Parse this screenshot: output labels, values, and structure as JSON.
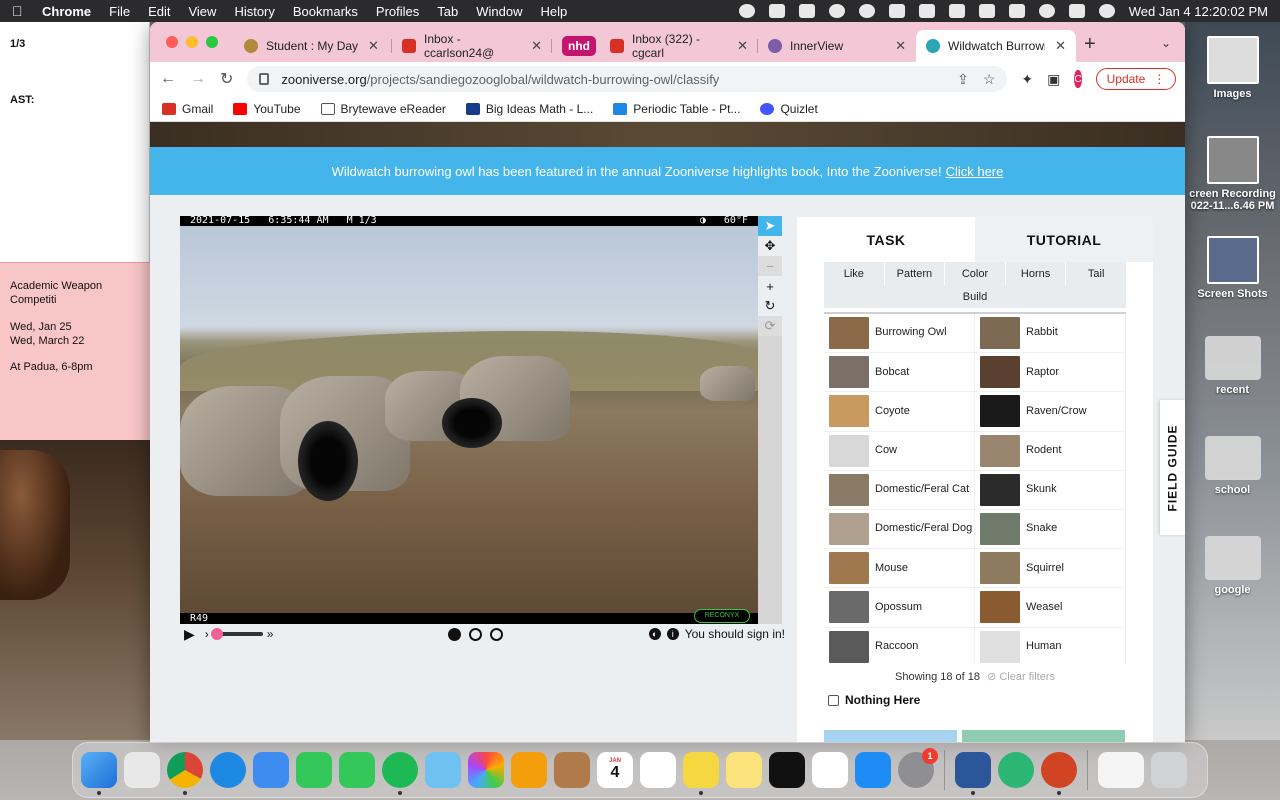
{
  "menubar": {
    "app": "Chrome",
    "items": [
      "File",
      "Edit",
      "View",
      "History",
      "Bookmarks",
      "Profiles",
      "Tab",
      "Window",
      "Help"
    ],
    "datetime": "Wed Jan 4  12:20:02 PM"
  },
  "sticky_white": {
    "line1": "1/3",
    "line2": "AST:"
  },
  "sticky_pink": {
    "title": "Academic Weapon Competiti",
    "date1": "Wed, Jan 25",
    "date2": "Wed, March 22",
    "place": "At Padua, 6-8pm"
  },
  "desktop_icons": [
    {
      "label": "Images"
    },
    {
      "label": "creen Recording\n022-11...6.46 PM"
    },
    {
      "label": "Screen Shots"
    },
    {
      "label": "recent"
    },
    {
      "label": "school"
    },
    {
      "label": "google"
    }
  ],
  "tabs": [
    {
      "title": "Student : My Day",
      "color": "#b08a3a"
    },
    {
      "title": "Inbox - ccarlson24@",
      "color": "#d93025"
    },
    {
      "title": "nhd",
      "color": "#c4156e"
    },
    {
      "title": "Inbox (322) - cgcarl",
      "color": "#d93025"
    },
    {
      "title": "InnerView",
      "color": "#7b5ea7"
    },
    {
      "title": "Wildwatch Burrowin",
      "color": "#2aa6b5"
    }
  ],
  "omnibox": {
    "host": "zooniverse.org",
    "path": "/projects/sandiegozooglobal/wildwatch-burrowing-owl/classify"
  },
  "update_label": "Update",
  "profile_initial": "C",
  "bookmarks": [
    {
      "label": "Gmail",
      "color": "#d93025"
    },
    {
      "label": "YouTube",
      "color": "#ff0000"
    },
    {
      "label": "Brytewave eReader",
      "color": "#555555"
    },
    {
      "label": "Big Ideas Math - L...",
      "color": "#1a3a8a"
    },
    {
      "label": "Periodic Table - Pt...",
      "color": "#1e88e5"
    },
    {
      "label": "Quizlet",
      "color": "#4255ff"
    }
  ],
  "banner": {
    "text": "Wildwatch burrowing owl has been featured in the annual Zooniverse highlights book, Into the Zooniverse!",
    "link": "Click here"
  },
  "camera": {
    "date": "2021-07-15",
    "time": "6:35:44 AM",
    "frame": "M 1/3",
    "temp": "60°F",
    "camera_id": "R49",
    "brand": "RECONYX"
  },
  "signin_text": "You should sign in!",
  "task_tabs": [
    "TASK",
    "TUTORIAL"
  ],
  "filters": [
    "Like",
    "Pattern",
    "Color",
    "Horns",
    "Tail"
  ],
  "filter_build": "Build",
  "choices": [
    {
      "label": "Burrowing Owl",
      "color": "#8a6a48"
    },
    {
      "label": "Rabbit",
      "color": "#7d6a55"
    },
    {
      "label": "Bobcat",
      "color": "#7a7068"
    },
    {
      "label": "Raptor",
      "color": "#5a4030"
    },
    {
      "label": "Coyote",
      "color": "#c89a60"
    },
    {
      "label": "Raven/Crow",
      "color": "#1a1a1a"
    },
    {
      "label": "Cow",
      "color": "#d8d8d8"
    },
    {
      "label": "Rodent",
      "color": "#9a8670"
    },
    {
      "label": "Domestic/Feral Cat",
      "color": "#8a7a66"
    },
    {
      "label": "Skunk",
      "color": "#2b2b2b"
    },
    {
      "label": "Domestic/Feral Dog",
      "color": "#b0a090"
    },
    {
      "label": "Snake",
      "color": "#6f7a6a"
    },
    {
      "label": "Mouse",
      "color": "#a07850"
    },
    {
      "label": "Squirrel",
      "color": "#8e7a5e"
    },
    {
      "label": "Opossum",
      "color": "#6a6a6a"
    },
    {
      "label": "Weasel",
      "color": "#8a5a30"
    },
    {
      "label": "Raccoon",
      "color": "#5a5a5a"
    },
    {
      "label": "Human",
      "color": "#e0e0e0"
    }
  ],
  "showing_text": "Showing 18 of 18",
  "clear_filters": "Clear filters",
  "nothing_here": "Nothing Here",
  "field_guide": "FIELD GUIDE",
  "dock": {
    "calendar_month": "JAN",
    "calendar_day": "4",
    "settings_badge": "1"
  },
  "colors": {
    "accent": "#43b5ea",
    "tabstrip": "#f3c7d6",
    "sticky_pink": "#f9c6c8"
  }
}
